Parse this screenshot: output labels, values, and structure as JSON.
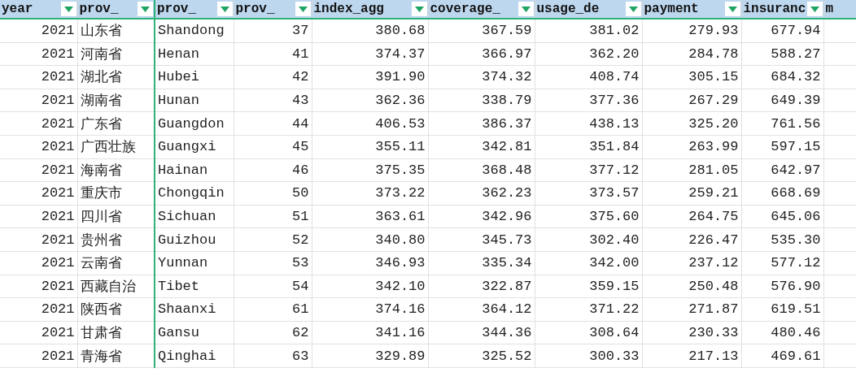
{
  "columns": [
    {
      "label": "year",
      "kind": "number"
    },
    {
      "label": "prov_",
      "kind": "text"
    },
    {
      "label": "prov_",
      "kind": "text"
    },
    {
      "label": "prov_",
      "kind": "number"
    },
    {
      "label": "index_agg",
      "kind": "number"
    },
    {
      "label": "coverage_",
      "kind": "number"
    },
    {
      "label": "usage_de",
      "kind": "number"
    },
    {
      "label": "payment",
      "kind": "number"
    },
    {
      "label": "insuranc",
      "kind": "number"
    },
    {
      "label": "m",
      "kind": "number"
    }
  ],
  "rows": [
    [
      "2021",
      "山东省",
      "Shandong",
      "37",
      "380.68",
      "367.59",
      "381.02",
      "279.93",
      "677.94"
    ],
    [
      "2021",
      "河南省",
      "Henan",
      "41",
      "374.37",
      "366.97",
      "362.20",
      "284.78",
      "588.27"
    ],
    [
      "2021",
      "湖北省",
      "Hubei",
      "42",
      "391.90",
      "374.32",
      "408.74",
      "305.15",
      "684.32"
    ],
    [
      "2021",
      "湖南省",
      "Hunan",
      "43",
      "362.36",
      "338.79",
      "377.36",
      "267.29",
      "649.39"
    ],
    [
      "2021",
      "广东省",
      "Guangdon",
      "44",
      "406.53",
      "386.37",
      "438.13",
      "325.20",
      "761.56"
    ],
    [
      "2021",
      "广西壮族",
      "Guangxi",
      "45",
      "355.11",
      "342.81",
      "351.84",
      "263.99",
      "597.15"
    ],
    [
      "2021",
      "海南省",
      "Hainan",
      "46",
      "375.35",
      "368.48",
      "377.12",
      "281.05",
      "642.97"
    ],
    [
      "2021",
      "重庆市",
      "Chongqin",
      "50",
      "373.22",
      "362.23",
      "373.57",
      "259.21",
      "668.69"
    ],
    [
      "2021",
      "四川省",
      "Sichuan",
      "51",
      "363.61",
      "342.96",
      "375.60",
      "264.75",
      "645.06"
    ],
    [
      "2021",
      "贵州省",
      "Guizhou",
      "52",
      "340.80",
      "345.73",
      "302.40",
      "226.47",
      "535.30"
    ],
    [
      "2021",
      "云南省",
      "Yunnan",
      "53",
      "346.93",
      "335.34",
      "342.00",
      "237.12",
      "577.12"
    ],
    [
      "2021",
      "西藏自治",
      "Tibet",
      "54",
      "342.10",
      "322.87",
      "359.15",
      "250.48",
      "576.90"
    ],
    [
      "2021",
      "陕西省",
      "Shaanxi",
      "61",
      "374.16",
      "364.12",
      "371.22",
      "271.87",
      "619.51"
    ],
    [
      "2021",
      "甘肃省",
      "Gansu",
      "62",
      "341.16",
      "344.36",
      "308.64",
      "230.33",
      "480.46"
    ],
    [
      "2021",
      "青海省",
      "Qinghai",
      "63",
      "329.89",
      "325.52",
      "300.33",
      "217.13",
      "469.61"
    ]
  ]
}
